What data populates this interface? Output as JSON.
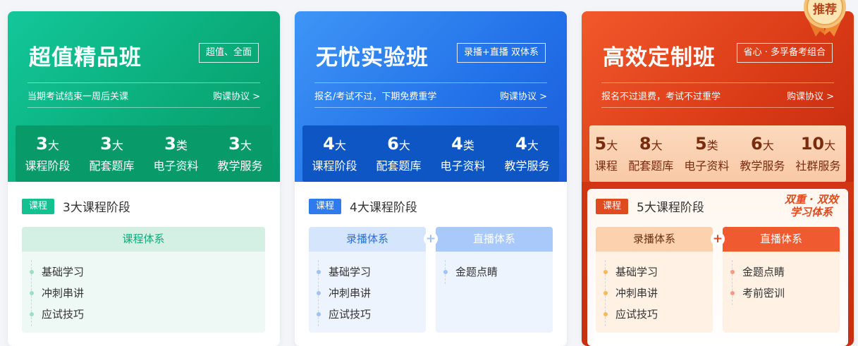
{
  "cards": [
    {
      "title": "超值精品班",
      "tag": "超值、全面",
      "subtitle": "当期考试结束一周后关课",
      "agreement": "购课协议 >",
      "stats": [
        {
          "num": "3",
          "unit": "大",
          "label": "课程阶段"
        },
        {
          "num": "3",
          "unit": "大",
          "label": "配套题库"
        },
        {
          "num": "3",
          "unit": "类",
          "label": "电子资料"
        },
        {
          "num": "3",
          "unit": "大",
          "label": "教学服务"
        }
      ],
      "badge": "课程",
      "course_text": "3大课程阶段",
      "systems": [
        {
          "title": "课程体系",
          "items": [
            "基础学习",
            "冲刺串讲",
            "应试技巧"
          ]
        }
      ]
    },
    {
      "title": "无忧实验班",
      "tag": "录播+直播 双体系",
      "subtitle": "报名/考试不过，下期免费重学",
      "agreement": "购课协议 >",
      "stats": [
        {
          "num": "4",
          "unit": "大",
          "label": "课程阶段"
        },
        {
          "num": "6",
          "unit": "大",
          "label": "配套题库"
        },
        {
          "num": "4",
          "unit": "类",
          "label": "电子资料"
        },
        {
          "num": "4",
          "unit": "大",
          "label": "教学服务"
        }
      ],
      "badge": "课程",
      "course_text": "4大课程阶段",
      "systems": [
        {
          "title": "录播体系",
          "items": [
            "基础学习",
            "冲刺串讲",
            "应试技巧"
          ]
        },
        {
          "title": "直播体系",
          "items": [
            "金题点睛"
          ]
        }
      ]
    },
    {
      "title": "高效定制班",
      "tag": "省心 · 多孚备考组合",
      "subtitle": "报名不过退费，考试不过重学",
      "agreement": "购课协议 >",
      "stats": [
        {
          "num": "5",
          "unit": "大",
          "label": "课程"
        },
        {
          "num": "8",
          "unit": "大",
          "label": "配套题库"
        },
        {
          "num": "5",
          "unit": "类",
          "label": "电子资料"
        },
        {
          "num": "6",
          "unit": "大",
          "label": "教学服务"
        },
        {
          "num": "10",
          "unit": "大",
          "label": "社群服务"
        }
      ],
      "badge": "课程",
      "course_text": "5大课程阶段",
      "slogan_line1": "双重 · 双效",
      "slogan_line2": "学习体系",
      "systems": [
        {
          "title": "录播体系",
          "items": [
            "基础学习",
            "冲刺串讲",
            "应试技巧"
          ]
        },
        {
          "title": "直播体系",
          "items": [
            "金题点睛",
            "考前密训"
          ]
        }
      ]
    }
  ],
  "medal": {
    "label": "推荐"
  },
  "plus_symbol": "+"
}
